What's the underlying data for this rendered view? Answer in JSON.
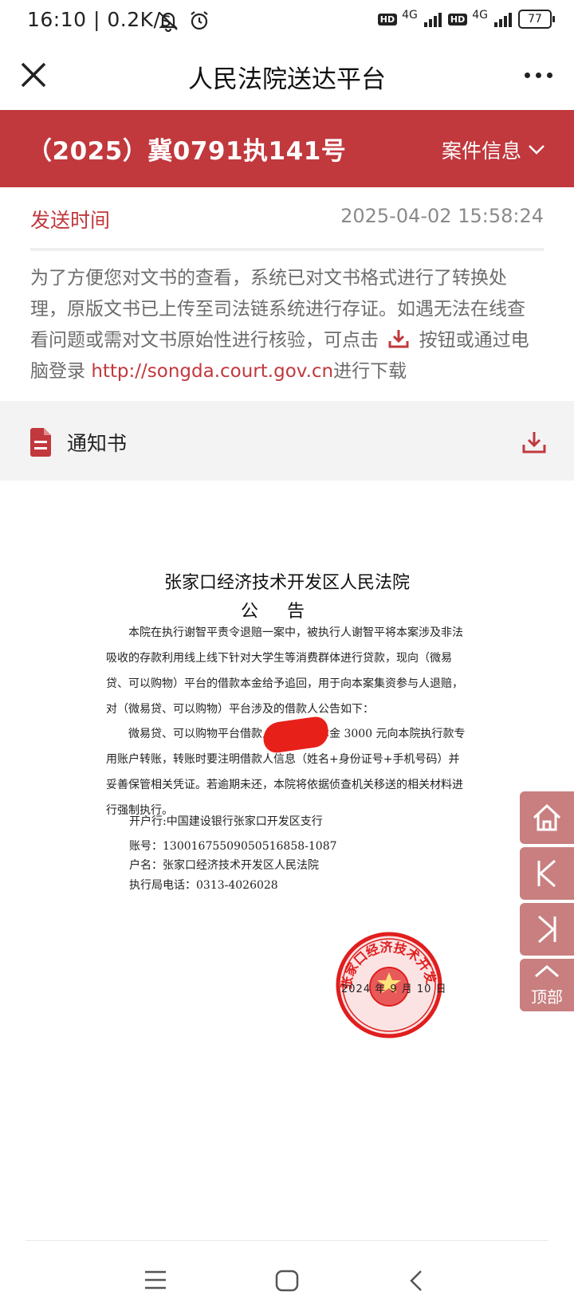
{
  "status_bar": {
    "time": "16:10 | 0.2K/s",
    "network1": "HD",
    "network1_type": "4G",
    "network2": "HD",
    "network2_type": "4G",
    "battery": "77"
  },
  "titlebar": {
    "title": "人民法院送达平台"
  },
  "case": {
    "number": "（2025）冀0791执141号",
    "info_label": "案件信息"
  },
  "send": {
    "label": "发送时间",
    "time": "2025-04-02 15:58:24"
  },
  "notice": {
    "text_before_icon": "为了方便您对文书的查看，系统已对文书格式进行了转换处理，原版文书已上传至司法链系统进行存证。如遇无法在线查看问题或需对文书原始性进行核验，可点击",
    "text_after_icon": "按钮或通过电脑登录",
    "link": "http://songda.court.gov.cn",
    "text_end": "进行下载"
  },
  "document_bar": {
    "name": "通知书"
  },
  "document": {
    "court": "张家口经济技术开发区人民法院",
    "heading": "公告",
    "p1": "本院在执行谢智平责令退赔一案中，被执行人谢智平将本案涉及非法吸收的存款利用线上线下针对大学生等消费群体进行贷款，现向（微易贷、可以购物）平台的借款本金给予追回，用于向本案集资参与人退赔，对（微易贷、可以购物）平台涉及的借款人公告如下：",
    "p2": "微易贷、可以购物平台借款人要尽快将本金 3000 元向本院执行款专用账户转账，转账时要注明借款人信息（姓名+身份证号+手机号码）并妥善保管相关凭证。若逾期未还，本院将依据侦查机关移送的相关材料进行强制执行。",
    "bank": "开户行:中国建设银行张家口开发区支行",
    "account": "账号：13001675509050516858-1087",
    "account_name": "户名：张家口经济技术开发区人民法院",
    "phone": "执行局电话：0313-4026028",
    "date": "2024 年 9 月 10 日",
    "seal_text": "张家口经济技术开发区人民法院"
  },
  "float_buttons": {
    "top_label": "顶部"
  },
  "colors": {
    "brand_red": "#c1383d",
    "float_btn": "#c97f7f"
  }
}
